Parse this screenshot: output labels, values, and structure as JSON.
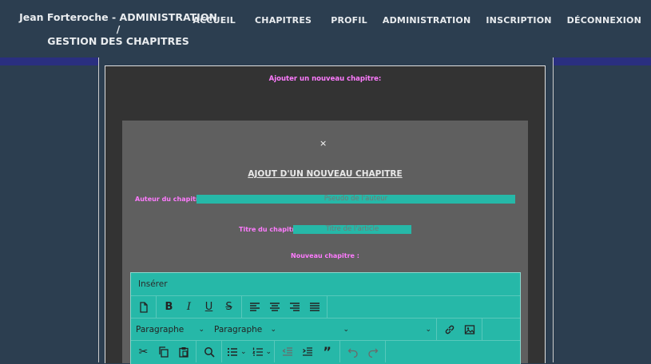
{
  "header": {
    "brand_line1": "Jean Forteroche - ADMINISTRATION /",
    "brand_line2": "GESTION DES CHAPITRES",
    "nav": [
      "ACCUEIL",
      "CHAPITRES",
      "PROFIL",
      "ADMINISTRATION",
      "INSCRIPTION",
      "DÉCONNEXION"
    ]
  },
  "page": {
    "add_title": "Ajouter un nouveau chapitre:"
  },
  "modal": {
    "close": "×",
    "title": "AJOUT D'UN NOUVEAU CHAPITRE",
    "author_label": "Auteur du chapitre :",
    "author_placeholder": "Pseudo de l'auteur",
    "title_label": "Titre du chapitre :",
    "title_placeholder": "Titre de l'article",
    "content_label": "Nouveau chapitre :"
  },
  "editor": {
    "menu": "Insérer",
    "format_select": "Paragraphe",
    "block_select": "Paragraphe",
    "font_select": "",
    "size_select": ""
  },
  "colors": {
    "accent": "#26b8a8",
    "label": "#ff7bff",
    "header_bg": "#2c3e50",
    "header_border": "#2a2f80"
  }
}
